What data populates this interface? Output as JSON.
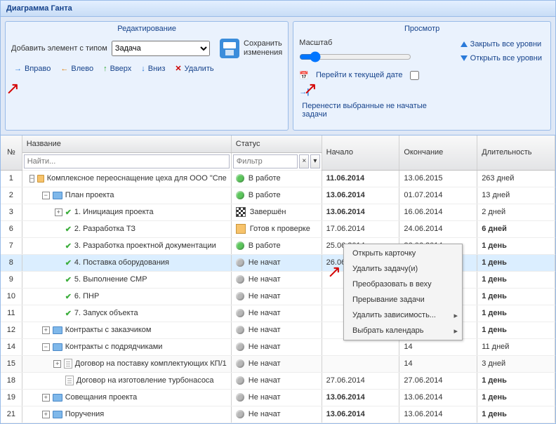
{
  "title": "Диаграмма Ганта",
  "edit": {
    "title": "Редактирование",
    "addLabel": "Добавить элемент с типом",
    "typeValue": "Задача",
    "saveLine1": "Сохранить",
    "saveLine2": "изменения",
    "right": "Вправо",
    "left": "Влево",
    "up": "Вверх",
    "down": "Вниз",
    "delete": "Удалить"
  },
  "view": {
    "title": "Просмотр",
    "scale": "Масштаб",
    "gotoToday": "Перейти к текущей дате",
    "moveUnstarted": "Перенести выбранные не начатые задачи",
    "collapseAll": "Закрыть все уровни",
    "expandAll": "Открыть все уровни"
  },
  "cols": {
    "num": "№",
    "name": "Название",
    "status": "Статус",
    "start": "Начало",
    "end": "Окончание",
    "dur": "Длительность"
  },
  "filters": {
    "find": "Найти...",
    "filter": "Фильтр"
  },
  "status": {
    "work": "В работе",
    "done": "Завершён",
    "ready": "Готов к проверке",
    "none": "Не начат"
  },
  "menu": {
    "open": "Открыть карточку",
    "del": "Удалить задачу(и)",
    "milestone": "Преобразовать в веху",
    "interrupt": "Прерывание задачи",
    "deps": "Удалить зависимость...",
    "cal": "Выбрать календарь"
  },
  "rows": [
    {
      "n": "1",
      "indent": 0,
      "exp": "-",
      "icon": "folder",
      "name": "Комплексное переоснащение цеха для ООО \"Спе",
      "st": "work",
      "dot": "green",
      "start": "11.06.2014",
      "end": "13.06.2015",
      "dur": "263 дней",
      "boldStart": true
    },
    {
      "n": "2",
      "indent": 1,
      "exp": "-",
      "icon": "folder-blue",
      "name": "План проекта",
      "st": "work",
      "dot": "green",
      "start": "13.06.2014",
      "end": "01.07.2014",
      "dur": "13 дней",
      "boldStart": true
    },
    {
      "n": "3",
      "indent": 2,
      "exp": "+",
      "icon": "check",
      "name": "1. Инициация проекта",
      "st": "done",
      "dot": "sq",
      "start": "13.06.2014",
      "end": "16.06.2014",
      "dur": "2 дней",
      "boldStart": true
    },
    {
      "n": "6",
      "indent": 2,
      "icon": "check",
      "name": "2. Разработка ТЗ",
      "st": "ready",
      "dot": "sq-orange",
      "start": "17.06.2014",
      "end": "24.06.2014",
      "dur": "6 дней",
      "boldDur": true
    },
    {
      "n": "7",
      "indent": 2,
      "icon": "check",
      "name": "3. Разработка проектной документации",
      "st": "work",
      "dot": "green",
      "start": "25.06.2014",
      "end": "26.06.2014",
      "dur": "1 день",
      "boldDur": true
    },
    {
      "n": "8",
      "indent": 2,
      "icon": "check",
      "name": "4. Поставка оборудования",
      "st": "none",
      "dot": "grey",
      "start": "26.06.2014",
      "end": "26.06.2014",
      "dur": "1 день",
      "boldDur": true,
      "sel": true
    },
    {
      "n": "9",
      "indent": 2,
      "icon": "check",
      "name": "5. Выполнение СМР",
      "st": "none",
      "dot": "grey",
      "start": "",
      "end": "14",
      "dur": "1 день",
      "boldDur": true
    },
    {
      "n": "10",
      "indent": 2,
      "icon": "check",
      "name": "6. ПНР",
      "st": "none",
      "dot": "grey",
      "start": "",
      "end": "14",
      "dur": "1 день",
      "boldDur": true
    },
    {
      "n": "11",
      "indent": 2,
      "icon": "check",
      "name": "7. Запуск объекта",
      "st": "none",
      "dot": "grey",
      "start": "",
      "end": "14",
      "dur": "1 день",
      "boldDur": true
    },
    {
      "n": "12",
      "indent": 1,
      "exp": "+",
      "icon": "folder-blue",
      "name": "Контракты с заказчиком",
      "st": "none",
      "dot": "grey",
      "start": "",
      "end": "14",
      "dur": "1 день",
      "boldDur": true
    },
    {
      "n": "14",
      "indent": 1,
      "exp": "-",
      "icon": "folder-blue",
      "name": "Контракты с подрядчиками",
      "st": "none",
      "dot": "grey",
      "start": "",
      "end": "14",
      "dur": "11 дней"
    },
    {
      "n": "15",
      "indent": 2,
      "exp": "+",
      "icon": "doc",
      "name": "Договор на поставку комплектующих КП/1",
      "st": "none",
      "dot": "grey",
      "start": "",
      "end": "14",
      "dur": "3 дней",
      "alt": true
    },
    {
      "n": "18",
      "indent": 2,
      "icon": "doc",
      "name": "Договор на изготовление турбонасоса",
      "st": "none",
      "dot": "grey",
      "start": "27.06.2014",
      "end": "27.06.2014",
      "dur": "1 день",
      "boldDur": true
    },
    {
      "n": "19",
      "indent": 1,
      "exp": "+",
      "icon": "folder-blue",
      "name": "Совещания проекта",
      "st": "none",
      "dot": "grey",
      "start": "13.06.2014",
      "end": "13.06.2014",
      "dur": "1 день",
      "boldStart": true,
      "boldDur": true
    },
    {
      "n": "21",
      "indent": 1,
      "exp": "+",
      "icon": "folder-blue",
      "name": "Поручения",
      "st": "none",
      "dot": "grey",
      "start": "13.06.2014",
      "end": "13.06.2014",
      "dur": "1 день",
      "boldStart": true,
      "boldDur": true
    }
  ]
}
